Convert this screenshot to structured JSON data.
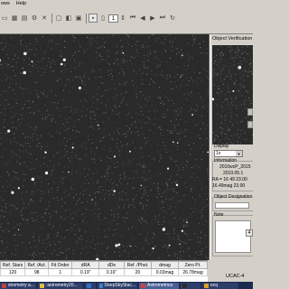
{
  "menu": {
    "items": [
      "ows",
      "Help"
    ]
  },
  "toolbar": {
    "page_value": "1"
  },
  "verification": {
    "title": "Object Verification",
    "display_label": "Display",
    "display_value": "1x",
    "information_label": "Information",
    "info_lines": [
      "2010wcP_2015",
      "2010.05.1",
      "RA = 16 49 23.00",
      "16.49mag  23.00"
    ],
    "designation_label": "Object Designation",
    "note_label": "Note",
    "scroll_value": "4"
  },
  "table": {
    "columns": [
      "Ref. Stars",
      "Ref. /Act.",
      "Fit Order",
      "dRA",
      "dDe",
      "Ref. /Phot.",
      "dmag",
      "Zero Pt."
    ],
    "rows": [
      [
        "120",
        "98",
        "1",
        "0.19\"",
        "0.16\"",
        "20",
        "0.03mag",
        "26.78mag"
      ]
    ]
  },
  "status": {
    "catalog": "UCAC-4"
  },
  "taskbar": {
    "items": [
      {
        "label": "strometry a...",
        "icon_color": "#c04040"
      },
      {
        "label": ":astrometry20...",
        "icon_color": "#e0c040"
      },
      {
        "label": "",
        "icon_color": "#3070c0"
      },
      {
        "label": "DeepSkyStac...",
        "icon_color": "#4080d0"
      },
      {
        "label": "Astrometrica",
        "icon_color": "#d04040"
      },
      {
        "label": "",
        "icon_color": "#2a2a2a"
      },
      {
        "label": "ecq",
        "icon_color": "#e0a020"
      }
    ]
  }
}
